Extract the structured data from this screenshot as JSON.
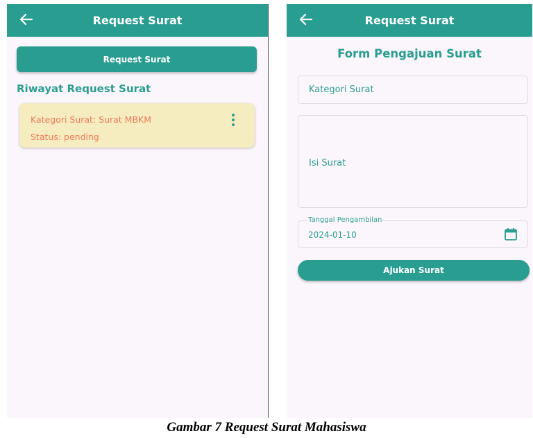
{
  "left_screen": {
    "appbar_title": "Request Surat",
    "request_button_label": "Request Surat",
    "history_title": "Riwayat Request Surat",
    "history_items": [
      {
        "category_text": "Kategori Surat: Surat MBKM",
        "status_text": "Status: pending"
      }
    ]
  },
  "right_screen": {
    "appbar_title": "Request Surat",
    "form_title": "Form Pengajuan Surat",
    "kategori_placeholder": "Kategori Surat",
    "isi_placeholder": "Isi Surat",
    "tanggal_label": "Tanggal Pengambilan",
    "tanggal_value": "2024-01-10",
    "submit_label": "Ajukan Surat"
  },
  "caption": "Gambar 7 Request Surat Mahasiswa",
  "colors": {
    "primary": "#2a9d91",
    "card_bg": "#f5ecc0",
    "card_text": "#ef7b57"
  },
  "icons": [
    "back-arrow-icon",
    "more-vert-icon",
    "calendar-icon"
  ]
}
